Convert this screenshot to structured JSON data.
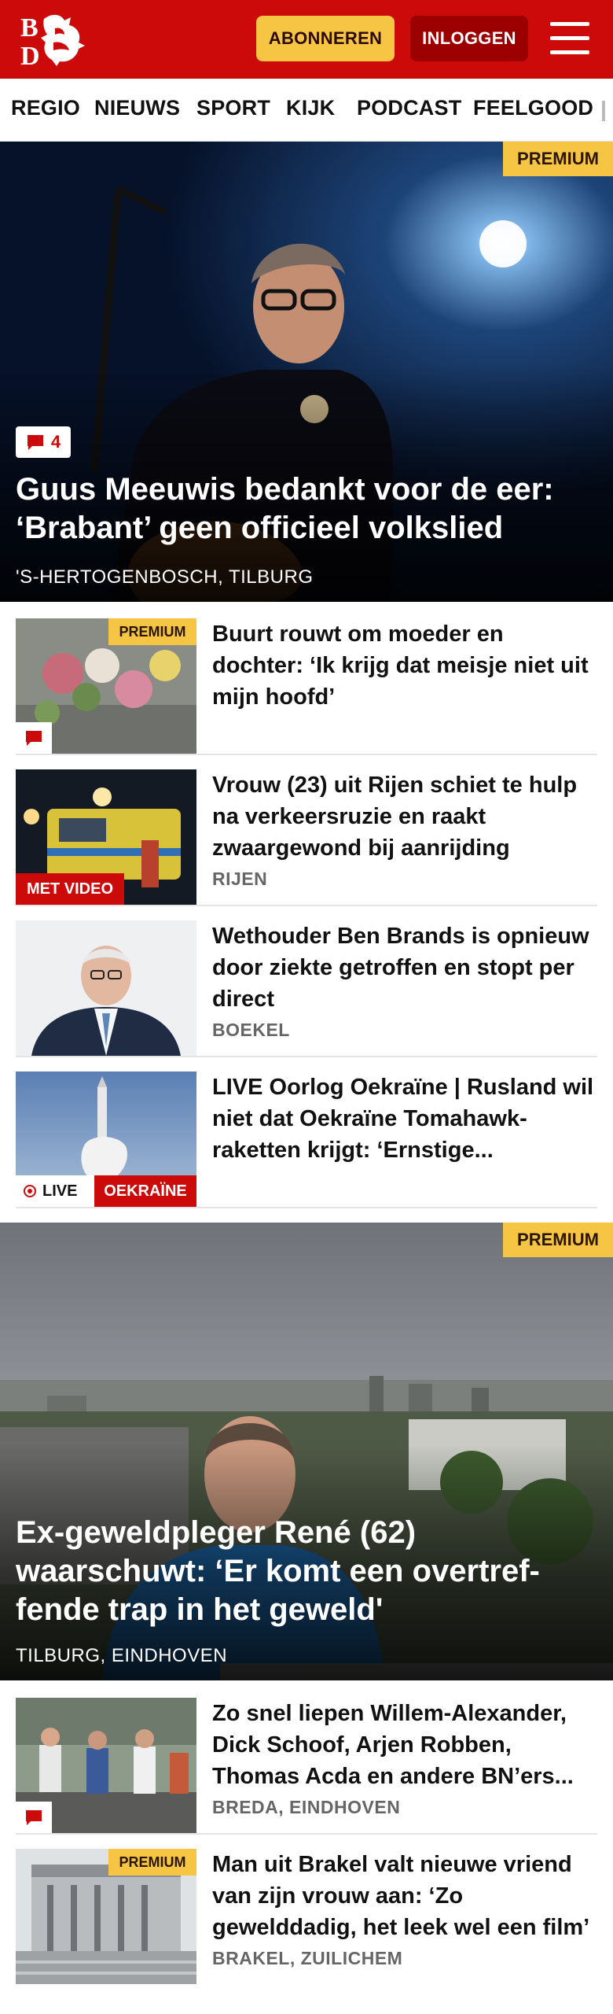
{
  "header": {
    "logo_text": "BD",
    "subscribe_label": "ABONNEREN",
    "login_label": "INLOGGEN"
  },
  "nav": {
    "items": [
      "REGIO",
      "NIEUWS",
      "SPORT",
      "KIJK",
      "PODCAST",
      "FEELGOOD"
    ]
  },
  "hero1": {
    "premium_label": "PREMIUM",
    "comment_count": "4",
    "title": "Guus Meeuwis bedankt voor de eer: ‘Brabant’ geen officieel volkslied",
    "location": "'S-HERTOGENBOSCH, TILBURG"
  },
  "list1": [
    {
      "title": "Buurt rouwt om moeder en dochter: ‘Ik krijg dat meisje niet uit mijn hoofd’",
      "location": "",
      "premium_label": "PREMIUM"
    },
    {
      "title": "Vrouw (23) uit Rijen schiet te hulp na verkeersruzie en raakt zwaargewond bij aanrijding",
      "location": "RIJEN",
      "video_label": "MET VIDEO"
    },
    {
      "title": "Wethouder Ben Brands is opnieuw door ziekte getroffen en stopt per direct",
      "location": "BOEKEL"
    },
    {
      "title": "LIVE Oorlog Oekraïne | Rusland wil niet dat Oekraïne Tomahawk-raketten krijgt: ‘Ernstige...",
      "location": "",
      "live_label": "LIVE",
      "topic_label": "OEKRAÏNE"
    }
  ],
  "hero2": {
    "premium_label": "PREMIUM",
    "title": "Ex-geweldpleger René (62) waarschuwt: ‘Er komt een overtref-fende trap in het geweld'",
    "location": "TILBURG, EINDHOVEN"
  },
  "list2": [
    {
      "title": "Zo snel liepen Willem-Alexander, Dick Schoof, Arjen Robben, Thomas Acda en andere BN’ers...",
      "location": "BREDA, EINDHOVEN"
    },
    {
      "title": "Man uit Brakel valt nieuwe vriend van zijn vrouw aan: ‘Zo gewelddadig, het leek wel een film’",
      "location": "BRAKEL, ZUILICHEM",
      "premium_label": "PREMIUM"
    }
  ],
  "colors": {
    "brand_red": "#cc0a0a",
    "premium_yellow": "#f6c544",
    "login_dark_red": "#9c0000"
  }
}
